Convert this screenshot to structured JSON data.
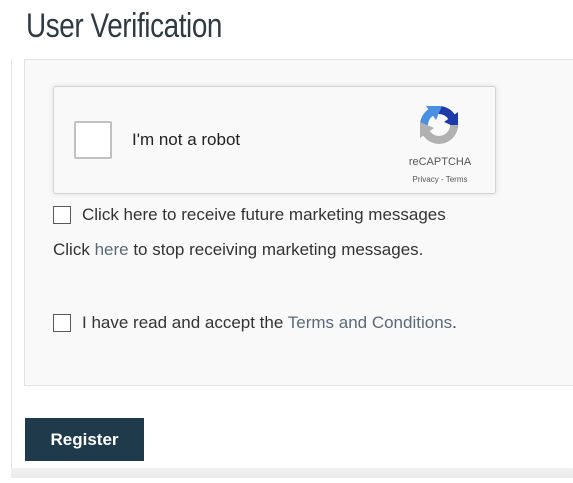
{
  "page": {
    "title": "User Verification"
  },
  "recaptcha": {
    "label": "I'm not a robot",
    "brand": "reCAPTCHA",
    "privacy_link": "Privacy",
    "link_separator": " - ",
    "terms_link": "Terms",
    "icon": "recaptcha-logo-icon",
    "checked": false
  },
  "marketing_optin": {
    "label": "Click here to receive future marketing messages",
    "checked": false
  },
  "marketing_optout": {
    "prefix": "Click ",
    "link_text": "here",
    "suffix": " to stop receiving marketing messages."
  },
  "terms": {
    "prefix": "I have read and accept the ",
    "link_text": "Terms and Conditions",
    "suffix": ".",
    "checked": false
  },
  "actions": {
    "register_label": "Register"
  },
  "colors": {
    "button_bg": "#1f3a4a",
    "link": "#5a6a78",
    "panel_bg": "#f9f9f9",
    "recaptcha_blue": "#4a90e2",
    "recaptcha_darkblue": "#1c3aa9",
    "recaptcha_gray": "#b1b1b1"
  }
}
